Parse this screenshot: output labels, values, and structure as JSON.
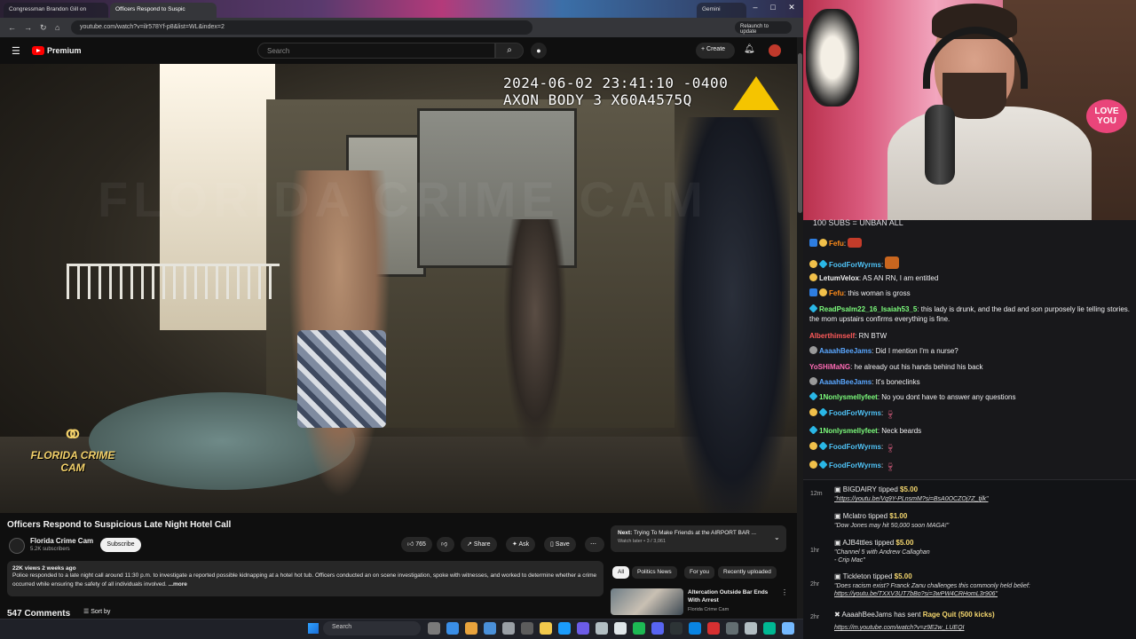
{
  "browser": {
    "tabs": [
      "Congressman Brandon Gill on",
      "Officers Respond to Suspic",
      "Gemini"
    ],
    "url": "youtube.com/watch?v=ilr578Yf-p8&list=WL&index=2",
    "relaunch_label": "Relaunch to update"
  },
  "youtube": {
    "logo_label": "Premium",
    "search_placeholder": "Search",
    "create_label": "+ Create"
  },
  "video": {
    "timestamp_line1": "2024-06-02 23:41:10 -0400",
    "timestamp_line2": "AXON BODY 3 X60A4575Q",
    "watermark": "FLORIDA CRIME CAM",
    "logo_text": "FLORIDA CRIME CAM",
    "title": "Officers Respond to Suspicious Late Night Hotel Call",
    "channel_name": "Florida Crime Cam",
    "channel_subs": "5.2K subscribers",
    "subscribe_label": "Subscribe",
    "like_count": "765",
    "share_label": "Share",
    "ask_label": "Ask",
    "save_label": "Save",
    "desc_meta": "22K views  2 weeks ago",
    "desc_text": "Police responded to a late night call around 11:30 p.m. to investigate a reported possible kidnapping at a hotel hot tub. Officers conducted an on scene investigation, spoke with witnesses, and worked to determine whether a crime occurred while ensuring the safety of all individuals involved.",
    "desc_more": " ...more",
    "comments_count": "547 Comments",
    "sort_label": "Sort by"
  },
  "up_next": {
    "label": "Next:",
    "title": "Trying To Make Friends at the AIRPORT BAR ...",
    "sub": "Watch later • 3 / 3,061"
  },
  "chips": [
    "All",
    "Politics News",
    "For you",
    "Recently uploaded"
  ],
  "recommended": {
    "title": "Altercation Outside Bar Ends With Arrest",
    "channel": "Florida Crime Cam"
  },
  "cam": {
    "sign": "LOVE YOU"
  },
  "chat": {
    "banner": "100 SUBS = UNBAN ALL",
    "messages": [
      {
        "user": "Fefu",
        "color": "#ff8c1a",
        "text": ""
      },
      {
        "user": "FoodForWyrms",
        "color": "#4fc3f7",
        "text": ""
      },
      {
        "user": "LetumVelox",
        "color": "#f1f1f1",
        "text": "AS AN RN, I am entitled"
      },
      {
        "user": "Fefu",
        "color": "#ff8c1a",
        "text": "this woman is gross"
      },
      {
        "user": "ReadPsalm22_16_Isaiah53_5",
        "color": "#7cfc7c",
        "text": "this lady is drunk, and the dad and son purposely lie telling stories. the mom upstairs confirms everything is fine."
      },
      {
        "user": "Alberthimself",
        "color": "#ff5a5a",
        "text": "RN BTW"
      },
      {
        "user": "AaaahBeeJams",
        "color": "#5aa7ff",
        "text": "Did I mention I'm a nurse?"
      },
      {
        "user": "YoSHiMaNG",
        "color": "#ff6bb5",
        "text": "he already out his hands behind his back"
      },
      {
        "user": "AaaahBeeJams",
        "color": "#5aa7ff",
        "text": "It's boneclinks"
      },
      {
        "user": "1Nonlysmellyfeet",
        "color": "#7cfc7c",
        "text": "No you dont have to answer any questions"
      },
      {
        "user": "FoodForWyrms",
        "color": "#4fc3f7",
        "text": ""
      },
      {
        "user": "1Nonlysmellyfeet",
        "color": "#7cfc7c",
        "text": "Neck beards"
      },
      {
        "user": "FoodForWyrms",
        "color": "#4fc3f7",
        "text": ""
      },
      {
        "user": "FoodForWyrms",
        "color": "#4fc3f7",
        "text": ""
      }
    ]
  },
  "tips": [
    {
      "time": "12m",
      "user": "BIGDAIRY",
      "verb": "tipped",
      "amount": "$5.00",
      "note": "\"https://youtu.be/Vq9Y-PLnsmM?si=BsA0OCZOj7Z_tjlk\""
    },
    {
      "time": "",
      "user": "Mclatro",
      "verb": "tipped",
      "amount": "$1.00",
      "note": "\"Dow Jones may hit 50,000 soon MAGA!\""
    },
    {
      "time": "1hr",
      "user": "AJB4ttles",
      "verb": "tipped",
      "amount": "$5.00",
      "note": "\"Channel 5 with Andrew Callaghan",
      "note2": "- Crip Mac\""
    },
    {
      "time": "2hr",
      "user": "Tickleton",
      "verb": "tipped",
      "amount": "$5.00",
      "note": "\"Does racism exist? Franck Zanu challenges this commonly held belief:",
      "note2": "https://youtu.be/TXXV3UT7bBo?si=3wPW4CRHomL3r906\""
    },
    {
      "time": "2hr",
      "user": "AaaahBeeJams",
      "verb": "has sent",
      "amount": "Rage Quit (500 kicks)",
      "note": "https://m.youtube.com/watch?v=z9E2w_LUEQI"
    }
  ],
  "taskbar": {
    "search_placeholder": "Search"
  }
}
